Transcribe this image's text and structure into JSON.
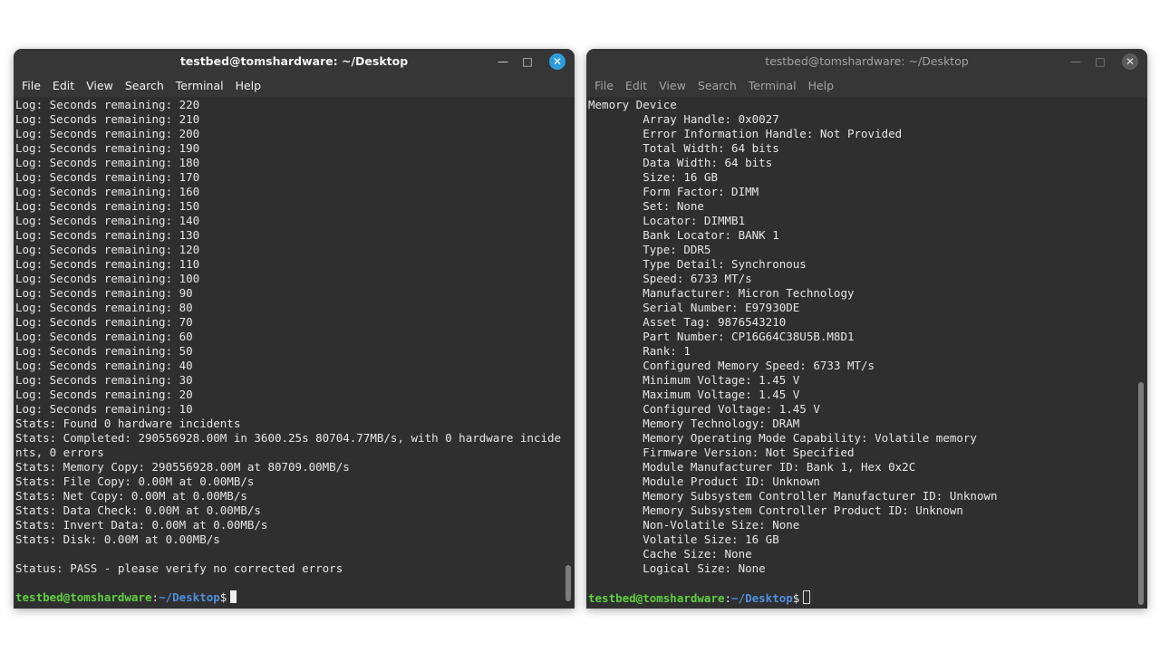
{
  "left": {
    "title": "testbed@tomshardware: ~/Desktop",
    "menu": [
      "File",
      "Edit",
      "View",
      "Search",
      "Terminal",
      "Help"
    ],
    "lines": [
      "Log: Seconds remaining: 220",
      "Log: Seconds remaining: 210",
      "Log: Seconds remaining: 200",
      "Log: Seconds remaining: 190",
      "Log: Seconds remaining: 180",
      "Log: Seconds remaining: 170",
      "Log: Seconds remaining: 160",
      "Log: Seconds remaining: 150",
      "Log: Seconds remaining: 140",
      "Log: Seconds remaining: 130",
      "Log: Seconds remaining: 120",
      "Log: Seconds remaining: 110",
      "Log: Seconds remaining: 100",
      "Log: Seconds remaining: 90",
      "Log: Seconds remaining: 80",
      "Log: Seconds remaining: 70",
      "Log: Seconds remaining: 60",
      "Log: Seconds remaining: 50",
      "Log: Seconds remaining: 40",
      "Log: Seconds remaining: 30",
      "Log: Seconds remaining: 20",
      "Log: Seconds remaining: 10",
      "Stats: Found 0 hardware incidents",
      "Stats: Completed: 290556928.00M in 3600.25s 80704.77MB/s, with 0 hardware incide",
      "nts, 0 errors",
      "Stats: Memory Copy: 290556928.00M at 80709.00MB/s",
      "Stats: File Copy: 0.00M at 0.00MB/s",
      "Stats: Net Copy: 0.00M at 0.00MB/s",
      "Stats: Data Check: 0.00M at 0.00MB/s",
      "Stats: Invert Data: 0.00M at 0.00MB/s",
      "Stats: Disk: 0.00M at 0.00MB/s",
      "",
      "Status: PASS - please verify no corrected errors",
      ""
    ],
    "prompt_user": "testbed@tomshardware",
    "prompt_sep": ":",
    "prompt_path": "~/Desktop",
    "prompt_symbol": "$"
  },
  "right": {
    "title": "testbed@tomshardware: ~/Desktop",
    "menu": [
      "File",
      "Edit",
      "View",
      "Search",
      "Terminal",
      "Help"
    ],
    "lines": [
      "Memory Device",
      "        Array Handle: 0x0027",
      "        Error Information Handle: Not Provided",
      "        Total Width: 64 bits",
      "        Data Width: 64 bits",
      "        Size: 16 GB",
      "        Form Factor: DIMM",
      "        Set: None",
      "        Locator: DIMMB1",
      "        Bank Locator: BANK 1",
      "        Type: DDR5",
      "        Type Detail: Synchronous",
      "        Speed: 6733 MT/s",
      "        Manufacturer: Micron Technology",
      "        Serial Number: E97930DE",
      "        Asset Tag: 9876543210",
      "        Part Number: CP16G64C38U5B.M8D1",
      "        Rank: 1",
      "        Configured Memory Speed: 6733 MT/s",
      "        Minimum Voltage: 1.45 V",
      "        Maximum Voltage: 1.45 V",
      "        Configured Voltage: 1.45 V",
      "        Memory Technology: DRAM",
      "        Memory Operating Mode Capability: Volatile memory",
      "        Firmware Version: Not Specified",
      "        Module Manufacturer ID: Bank 1, Hex 0x2C",
      "        Module Product ID: Unknown",
      "        Memory Subsystem Controller Manufacturer ID: Unknown",
      "        Memory Subsystem Controller Product ID: Unknown",
      "        Non-Volatile Size: None",
      "        Volatile Size: 16 GB",
      "        Cache Size: None",
      "        Logical Size: None",
      ""
    ],
    "prompt_user": "testbed@tomshardware",
    "prompt_sep": ":",
    "prompt_path": "~/Desktop",
    "prompt_symbol": "$"
  },
  "icons": {
    "minimize": "minimize-icon",
    "maximize": "maximize-icon",
    "close": "close-icon"
  },
  "colors": {
    "prompt_user": "#5fd040",
    "prompt_path": "#4f8fe0",
    "close_active": "#2d9cdb",
    "terminal_bg": "#2f2f2f"
  }
}
